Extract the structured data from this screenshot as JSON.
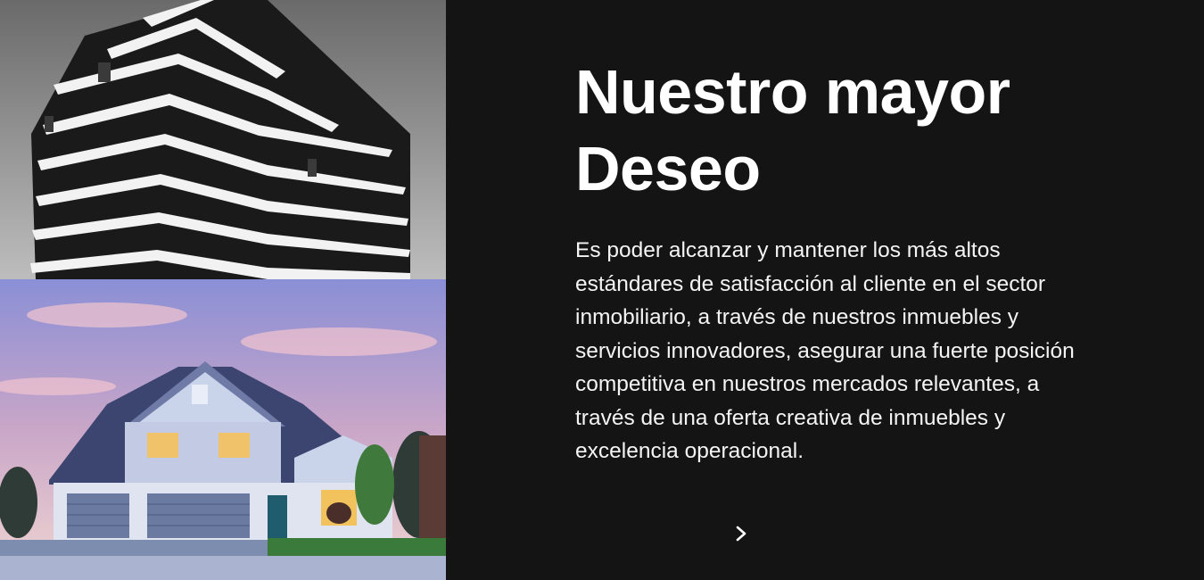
{
  "images": {
    "top": {
      "name": "building-photo",
      "tone": "grayscale"
    },
    "bottom": {
      "name": "house-photo",
      "tone": "color"
    }
  },
  "content": {
    "headline": "Nuestro mayor\nDeseo",
    "body": "Es poder alcanzar y mantener los más altos estándares de satisfacción al cliente en el sector inmobiliario, a través de nuestros inmuebles y servicios innovadores, asegurar una fuerte posición competitiva en nuestros mercados relevantes, a través de una oferta creativa de inmuebles y excelencia operacional."
  },
  "navigation": {
    "next_icon": "chevron-right-icon"
  },
  "colors": {
    "background": "#141414",
    "text": "#ffffff"
  }
}
